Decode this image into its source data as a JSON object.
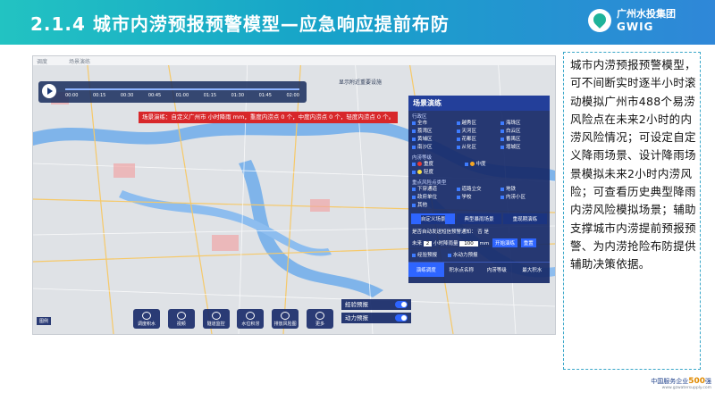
{
  "header": {
    "title": "2.1.4 城市内涝预报预警模型—应急响应提前布防",
    "logo_cn": "广州水投集团",
    "logo_en": "GWIG"
  },
  "screen": {
    "topbar_left": "调度",
    "topbar_item": "场景演练",
    "history_link": "显示附近重要设施",
    "timeline_ticks": [
      "00:00",
      "00:15",
      "00:30",
      "00:45",
      "01:00",
      "01:15",
      "01:30",
      "01:45",
      "02:00"
    ],
    "banner": "场景演练：自定义广州市 小时降雨 mm，重度内涝点 0 个，中度内涝点 0 个，轻度内涝点 0 个。",
    "panel": {
      "title": "场景演练",
      "district_label": "行政区",
      "districts": [
        "全市",
        "越秀区",
        "海珠区",
        "荔湾区",
        "天河区",
        "白云区",
        "黄埔区",
        "花都区",
        "番禺区",
        "南沙区",
        "从化区",
        "增城区"
      ],
      "risk_label": "内涝等级",
      "risks": [
        "重度",
        "中度",
        "轻度"
      ],
      "types_label": "重点风险点类型",
      "types": [
        "下穿通道",
        "道路立交",
        "地铁",
        "政府单位",
        "学校",
        "内涝小区",
        "其他"
      ],
      "tabs": [
        "自定义场景",
        "典型暴雨场景",
        "重现期演练"
      ],
      "option_row": "是否自动发送短信预警通知：",
      "option_no": "否",
      "option_yes": "是",
      "duration_label": "未来",
      "duration_value": "2",
      "rain_label": "小时降雨量",
      "rain_value": "100",
      "unit": "mm",
      "start_btn": "开始演练",
      "reset_btn": "重置",
      "warn_opts": [
        "经验预报",
        "水动力预报"
      ],
      "subtabs": [
        "演练调度",
        "积水点名称",
        "内涝等级",
        "最大积水"
      ]
    },
    "toggles": [
      "经验预报",
      "动力预报"
    ],
    "bottom_buttons": [
      "调度积水",
      "视频",
      "隧道监控",
      "水位积涝",
      "排放风险图",
      "更多"
    ],
    "bottom_left": "图例"
  },
  "description": "城市内涝预报预警模型，可不间断实时逐半小时滚动模拟广州市488个易涝风险点在未来2小时的内涝风险情况；可设定自定义降雨场景、设计降雨场景模拟未来2小时内涝风险；可查看历史典型降雨内涝风险模拟场景；辅助支撑城市内涝提前预报预警、为内涝抢险布防提供辅助决策依据。",
  "footer": {
    "line1_prefix": "中国服务企业",
    "line1_number": "500",
    "line1_suffix": "强",
    "line2": "www.gzwatersupply.com"
  },
  "colors": {
    "header_start": "#22c3c2",
    "header_end": "#2f87d8",
    "panel": "#162968",
    "banner": "#d8272a",
    "river": "#7fb4ea"
  }
}
